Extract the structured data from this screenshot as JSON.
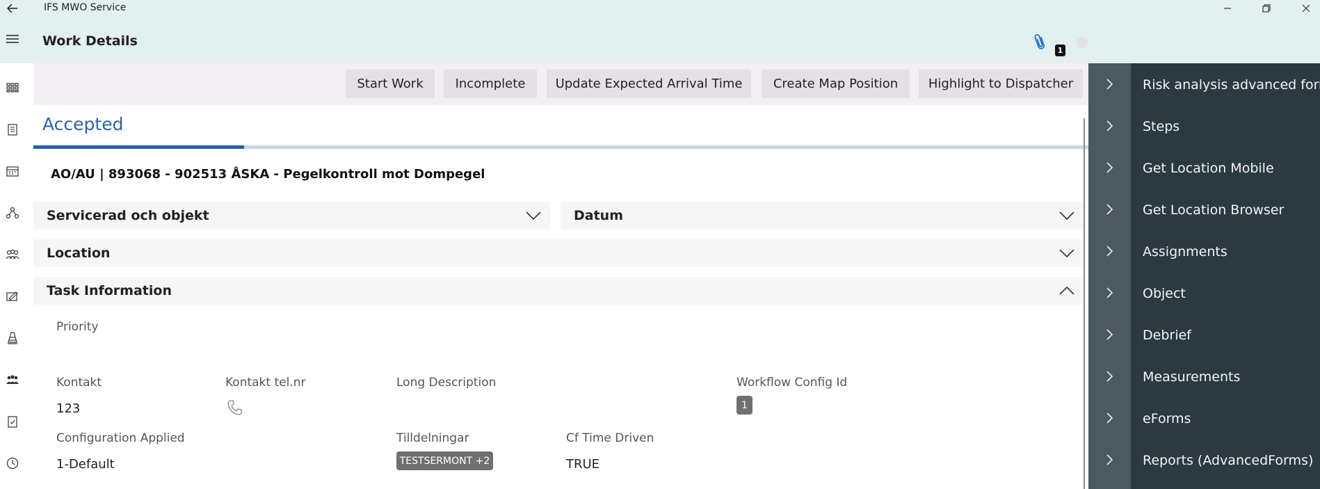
{
  "window": {
    "app_title": "IFS MWO Service"
  },
  "header": {
    "page_title": "Work Details",
    "attachment_count": "1"
  },
  "actions": [
    {
      "label": "Start Work"
    },
    {
      "label": "Incomplete"
    },
    {
      "label": "Update Expected Arrival Time"
    },
    {
      "label": "Create Map Position"
    },
    {
      "label": "Highlight to Dispatcher"
    }
  ],
  "status": {
    "label": "Accepted",
    "progress_fraction": 0.2
  },
  "work_order": {
    "title": "AO/AU | 893068 - 902513 ÅSKA - Pegelkontroll mot Dompegel"
  },
  "sections": {
    "servicerad": "Servicerad och objekt",
    "datum": "Datum",
    "location": "Location",
    "task_information": "Task Information"
  },
  "fields": {
    "priority_label": "Priority",
    "kontakt_label": "Kontakt",
    "kontakt_value": "123",
    "kontakt_tel_label": "Kontakt tel.nr",
    "long_description_label": "Long Description",
    "workflow_config_label": "Workflow Config Id",
    "workflow_config_value": "1",
    "configuration_label": "Configuration Applied",
    "configuration_value": "1-Default",
    "tilldelningar_label": "Tilldelningar",
    "tilldelningar_value": "TESTSERMONT +2",
    "cf_time_label": "Cf Time Driven",
    "cf_time_value": "TRUE"
  },
  "right_menu": [
    {
      "label": "Risk analysis advanced forms"
    },
    {
      "label": "Steps"
    },
    {
      "label": "Get Location Mobile"
    },
    {
      "label": "Get Location Browser"
    },
    {
      "label": "Assignments"
    },
    {
      "label": "Object"
    },
    {
      "label": "Debrief"
    },
    {
      "label": "Measurements"
    },
    {
      "label": "eForms"
    },
    {
      "label": "Reports (AdvancedForms)"
    }
  ],
  "icons": {
    "back": "arrow-left-icon",
    "menu": "hamburger-icon",
    "attachment": "paperclip-icon",
    "phone": "phone-icon"
  }
}
